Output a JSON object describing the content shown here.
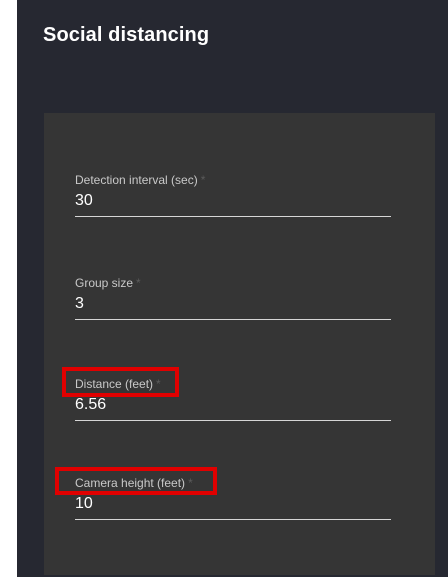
{
  "page": {
    "title": "Social distancing"
  },
  "form": {
    "fields": [
      {
        "label": "Detection interval (sec)",
        "required_mark": "*",
        "value": "30"
      },
      {
        "label": "Group size",
        "required_mark": "*",
        "value": "3"
      },
      {
        "label": "Distance (feet)",
        "required_mark": "*",
        "value": "6.56"
      },
      {
        "label": "Camera height (feet)",
        "required_mark": "*",
        "value": "10"
      }
    ]
  },
  "colors": {
    "panel_background": "#262831",
    "card_background": "#353535",
    "highlight": "#e10000",
    "underline": "#d6d6d6"
  }
}
